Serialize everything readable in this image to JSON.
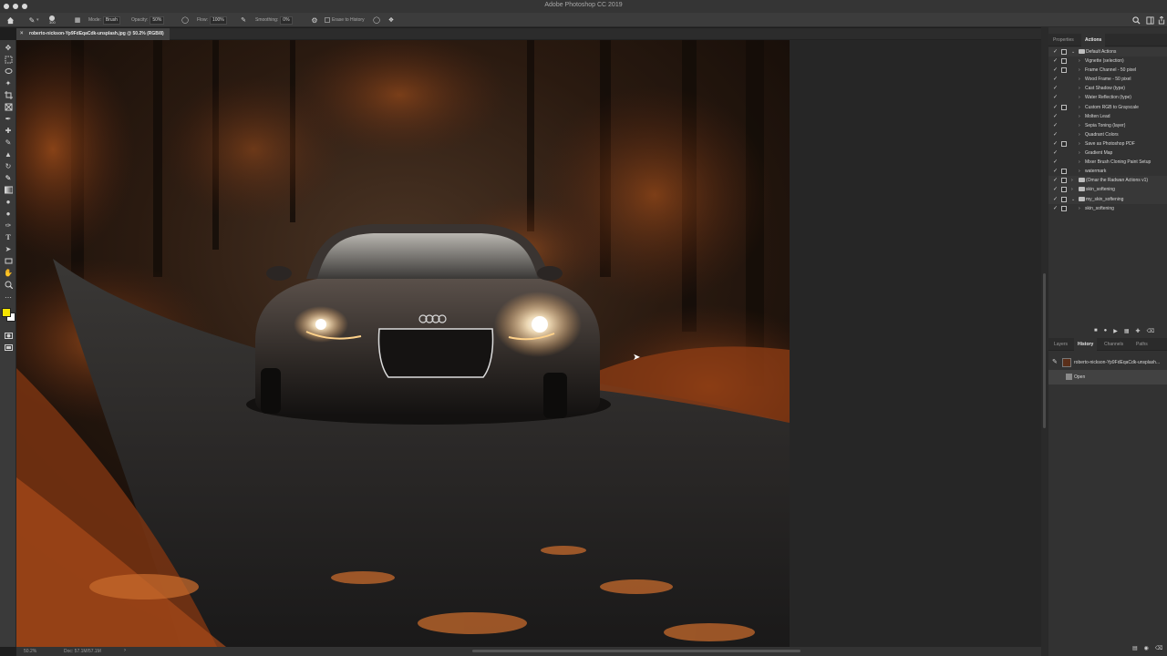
{
  "app": {
    "title": "Adobe Photoshop CC 2019"
  },
  "options_bar": {
    "brush_size": "300",
    "mode_label": "Mode:",
    "mode_value": "Brush",
    "opacity_label": "Opacity:",
    "opacity_value": "50%",
    "flow_label": "Flow:",
    "flow_value": "100%",
    "smoothing_label": "Smoothing:",
    "smoothing_value": "0%",
    "erase_to_history_label": "Erase to History"
  },
  "document": {
    "tab_title": "roberto-nickson-Yp9FdEqaCdk-unsplash.jpg @ 50.2% (RGB/8)"
  },
  "status_bar": {
    "zoom": "50.2%",
    "doc_size": "Doc: 57.1M/57.1M"
  },
  "panels": {
    "top_tabs": [
      "Properties",
      "Actions"
    ],
    "actions": [
      {
        "label": "Default Actions",
        "type": "set",
        "expanded": true,
        "dialog": true
      },
      {
        "label": "Vignette (selection)",
        "type": "item",
        "dialog": true
      },
      {
        "label": "Frame Channel - 50 pixel",
        "type": "item",
        "dialog": true
      },
      {
        "label": "Wood Frame - 50 pixel",
        "type": "item",
        "dialog": false
      },
      {
        "label": "Cast Shadow (type)",
        "type": "item",
        "dialog": false
      },
      {
        "label": "Water Reflection (type)",
        "type": "item",
        "dialog": false
      },
      {
        "label": "Custom RGB to Grayscale",
        "type": "item",
        "dialog": true
      },
      {
        "label": "Molten Lead",
        "type": "item",
        "dialog": false
      },
      {
        "label": "Sepia Toning (layer)",
        "type": "item",
        "dialog": false
      },
      {
        "label": "Quadrant Colors",
        "type": "item",
        "dialog": false
      },
      {
        "label": "Save as Photoshop PDF",
        "type": "item",
        "dialog": true
      },
      {
        "label": "Gradient Map",
        "type": "item",
        "dialog": false
      },
      {
        "label": "Mixer Brush Cloning Paint Setup",
        "type": "item",
        "dialog": false
      },
      {
        "label": "watermark",
        "type": "item",
        "dialog": true
      },
      {
        "label": "(Omar the Radwan Actions v1)",
        "type": "set",
        "expanded": false,
        "dialog": true
      },
      {
        "label": "skin_softening",
        "type": "set",
        "expanded": false,
        "dialog": true
      },
      {
        "label": "my_skin_softening",
        "type": "set",
        "expanded": true,
        "dialog": true
      },
      {
        "label": "skin_softening",
        "type": "item",
        "dialog": true
      }
    ],
    "lower_tabs": [
      "Layers",
      "History",
      "Channels",
      "Paths"
    ],
    "history": {
      "snapshot_label": "roberto-nickson-Yp9FdEqaCdk-unsplash...",
      "states": [
        "Open"
      ]
    }
  },
  "colors": {
    "foreground": "#f5e400",
    "background": "#ffffff",
    "ui_dark": "#323232"
  }
}
